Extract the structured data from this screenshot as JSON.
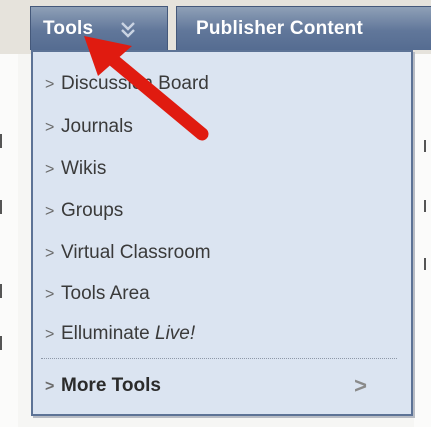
{
  "tabs": {
    "tools_label": "Tools",
    "publisher_label": "Publisher Content"
  },
  "menu": {
    "items": [
      "Discussion Board",
      "Journals",
      "Wikis",
      "Groups",
      "Virtual Classroom",
      "Tools Area"
    ],
    "elluminate_prefix": "Elluminate ",
    "elluminate_live": "Live!",
    "more_tools": "More Tools",
    "caret": ">",
    "more_arrow": ">"
  },
  "colors": {
    "tab_bg": "#61779a",
    "menu_bg": "#dbe4f1",
    "menu_border": "#5d7396",
    "arrow_red": "#e01b10"
  },
  "icons": {
    "tab_chevron": "double-chevron-down-icon",
    "annotation": "red-arrow-icon"
  }
}
